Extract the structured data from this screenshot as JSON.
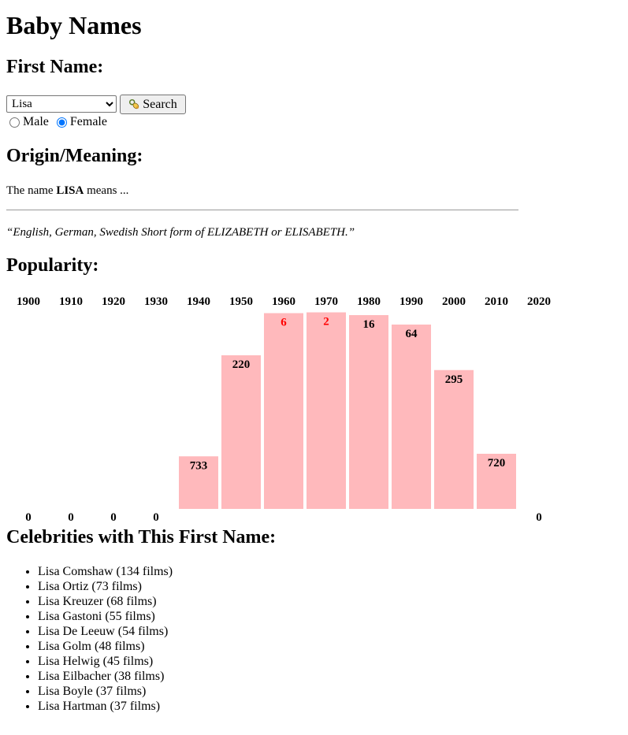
{
  "title": "Baby Names",
  "first_name_heading": "First Name:",
  "name_select": {
    "selected": "Lisa"
  },
  "search_button_label": "Search",
  "gender": {
    "male_label": "Male",
    "female_label": "Female",
    "selected": "Female"
  },
  "origin_heading": "Origin/Meaning:",
  "meaning": {
    "prefix": "The name",
    "name": "LISA",
    "suffix": "means ...",
    "quote": "“English, German, Swedish Short form of ELIZABETH or ELISABETH.”"
  },
  "popularity_heading": "Popularity:",
  "chart_data": {
    "type": "bar",
    "categories": [
      "1900",
      "1910",
      "1920",
      "1930",
      "1940",
      "1950",
      "1960",
      "1970",
      "1980",
      "1990",
      "2000",
      "2010",
      "2020"
    ],
    "values": [
      0,
      0,
      0,
      0,
      733,
      220,
      6,
      2,
      16,
      64,
      295,
      720,
      0
    ],
    "value_meaning": "popularity rank (lower is more popular; 0 = unranked)",
    "max_rank": 1000,
    "bar_color": "#ffb9bc",
    "top_rank_color": "#ff0000"
  },
  "celebrities_heading": "Celebrities with This First Name:",
  "celebrities": [
    "Lisa Comshaw (134 films)",
    "Lisa Ortiz (73 films)",
    "Lisa Kreuzer (68 films)",
    "Lisa Gastoni (55 films)",
    "Lisa De Leeuw (54 films)",
    "Lisa Golm (48 films)",
    "Lisa Helwig (45 films)",
    "Lisa Eilbacher (38 films)",
    "Lisa Boyle (37 films)",
    "Lisa Hartman (37 films)"
  ]
}
